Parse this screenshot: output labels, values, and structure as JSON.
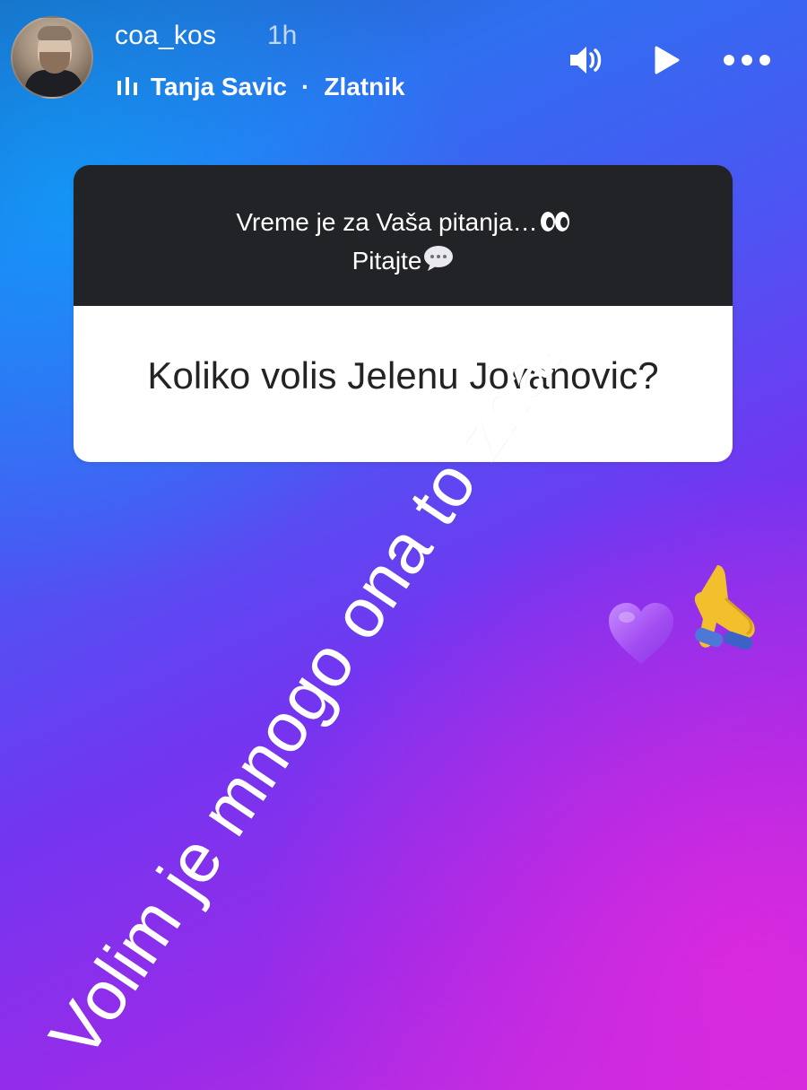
{
  "header": {
    "username": "coa_kos",
    "time": "1h",
    "music": {
      "artist": "Tanja Savic",
      "separator": "·",
      "title": "Zlatnik"
    }
  },
  "question_card": {
    "prompt_line1": "Vreme je za Vaša pitanja…",
    "prompt_line2": "Pitajte",
    "question": "Koliko volis Jelenu Jovanovic?"
  },
  "answer": {
    "text": "Volim je mnogo ona to zna!"
  },
  "icons": {
    "volume": "volume-icon",
    "play": "play-icon",
    "more": "more-icon",
    "music": "music-icon",
    "eyes": "eyes-emoji",
    "speech": "speech-bubble-emoji",
    "heart": "purple-heart-emoji",
    "pray": "folded-hands-emoji"
  },
  "colors": {
    "card_top": "#222326",
    "card_bottom": "#ffffff",
    "text_light": "#ffffff",
    "text_dark": "#232323"
  }
}
